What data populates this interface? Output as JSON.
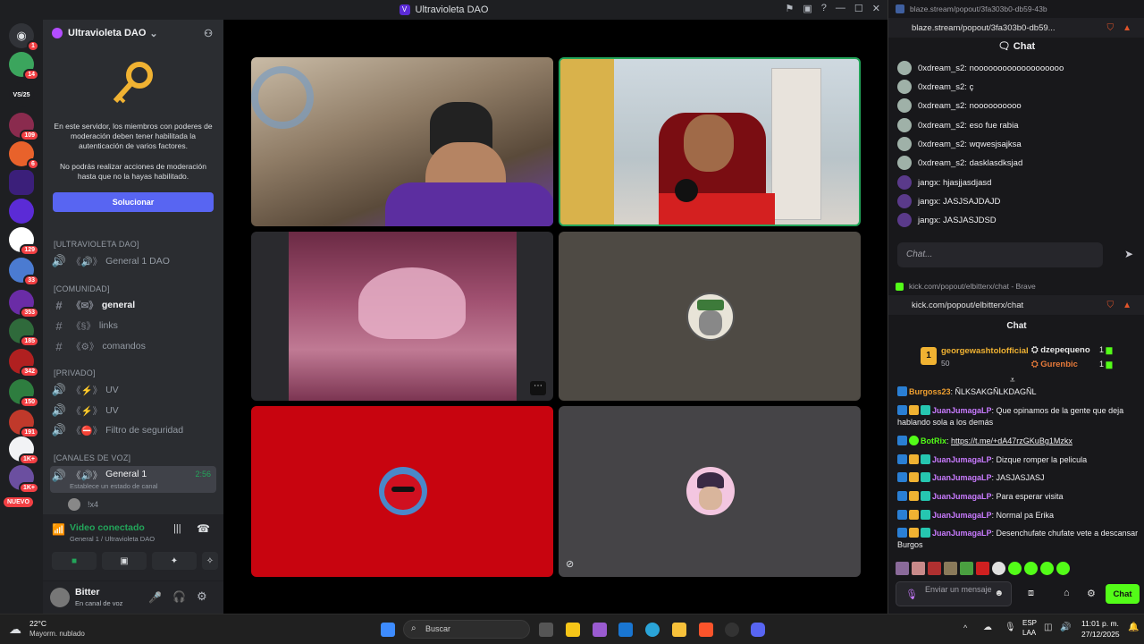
{
  "window": {
    "title": "Ultravioleta DAO"
  },
  "servers": [
    {
      "name": "discord-home",
      "badge": "1"
    },
    {
      "name": "server-2",
      "badge": "14"
    },
    {
      "name": "server-3",
      "badge": ""
    },
    {
      "name": "server-4",
      "badge": "109"
    },
    {
      "name": "server-5",
      "badge": "6"
    },
    {
      "name": "server-6",
      "badge": ""
    },
    {
      "name": "server-7",
      "badge": ""
    },
    {
      "name": "server-8",
      "badge": "129"
    },
    {
      "name": "server-9",
      "badge": "33"
    },
    {
      "name": "server-10",
      "badge": "353"
    },
    {
      "name": "server-11",
      "badge": "185"
    },
    {
      "name": "server-12",
      "badge": "342"
    },
    {
      "name": "server-13",
      "badge": "150"
    },
    {
      "name": "server-14",
      "badge": "191"
    },
    {
      "name": "server-15",
      "badge": "1K+"
    },
    {
      "name": "server-16",
      "badge": "1K+"
    },
    {
      "name": "server-17",
      "badge": "NUEVO"
    }
  ],
  "server_rail": {
    "label_vs": "VS/25"
  },
  "guild": {
    "name": "Ultravioleta DAO"
  },
  "notice": {
    "text1": "En este servidor, los miembros con poderes de moderación deben tener habilitada la autenticación de varios factores.",
    "text2": "No podrás realizar acciones de moderación hasta que no la hayas habilitado.",
    "button": "Solucionar"
  },
  "channels": {
    "cat1": "[ULTRAVIOLETA DAO]",
    "c1": "General 1 DAO",
    "cat2": "[COMUNIDAD]",
    "c2": "general",
    "c3": "links",
    "c4": "comandos",
    "cat3": "[PRIVADO]",
    "c5": "UV",
    "c6": "UV",
    "c7": "Filtro de seguridad",
    "cat4": "[CANALES DE VOZ]",
    "c8": "General 1",
    "c8_time": "2:56",
    "c8_status": "Establece un estado de canal",
    "voice_user": "!x4"
  },
  "voice": {
    "status": "Video conectado",
    "location": "General 1 / Ultravioleta DAO"
  },
  "user": {
    "name": "Bitter",
    "status": "En canal de voz"
  },
  "stream_window": {
    "url_title": "blaze.stream/popout/3fa303b0-db59-43b",
    "address": "blaze.stream/popout/3fa303b0-db59...",
    "header": "Chat",
    "messages": [
      {
        "user": "0xdream_s2",
        "text": "nooooooooooooooooooo"
      },
      {
        "user": "0xdream_s2",
        "text": "ç"
      },
      {
        "user": "0xdream_s2",
        "text": "noooooooooo"
      },
      {
        "user": "0xdream_s2",
        "text": "eso fue rabia"
      },
      {
        "user": "0xdream_s2",
        "text": "wqwesjsajksa"
      },
      {
        "user": "0xdream_s2",
        "text": "dasklasdksjad"
      },
      {
        "user": "jangx",
        "text": "hjasjjasdjasd"
      },
      {
        "user": "jangx",
        "text": "JASJSAJDAJD"
      },
      {
        "user": "jangx",
        "text": "JASJASJDSD"
      }
    ],
    "input_placeholder": "Chat..."
  },
  "kick_window": {
    "url_title": "kick.com/popout/elbitterx/chat - Brave",
    "address": "kick.com/popout/elbitterx/chat",
    "header": "Chat",
    "top_gifter": {
      "rank": "1",
      "name": "georgewashtolofficial",
      "count": "50"
    },
    "gifters": [
      {
        "name": "dzepequeno",
        "count": "1"
      },
      {
        "name": "Gurenbic",
        "count": "1"
      }
    ],
    "messages": [
      {
        "user": "Burgoss23",
        "text": ": ÑLKSAKGÑLKDAGÑL"
      },
      {
        "user": "JuanJumagaLP",
        "text": ": Que opinamos de la gente que deja hablando sola a los demás"
      },
      {
        "user": "BotRix",
        "text": ": ",
        "link": "https://t.me/+dA47rzGKuBg1Mzkx"
      },
      {
        "user": "JuanJumagaLP",
        "text": ": Dizque romper la pelicula"
      },
      {
        "user": "JuanJumagaLP",
        "text": ": JASJASJASJ"
      },
      {
        "user": "JuanJumagaLP",
        "text": ": Para esperar visita"
      },
      {
        "user": "JuanJumagaLP",
        "text": ": Normal pa Erika"
      },
      {
        "user": "JuanJumagaLP",
        "text": ": Desenchufate chufate vete a descansar Burgos"
      }
    ],
    "input_placeholder": "Enviar un mensaje",
    "chat_button": "Chat"
  },
  "taskbar": {
    "weather_temp": "22°C",
    "weather_desc": "Mayorm. nublado",
    "search_placeholder": "Buscar",
    "lang1": "ESP",
    "lang2": "LAA",
    "time": "11:01 p. m.",
    "date": "27/12/2025"
  },
  "colors": {
    "accent": "#5865f2",
    "kick_green": "#53fc18",
    "speaking": "#23a55a"
  }
}
